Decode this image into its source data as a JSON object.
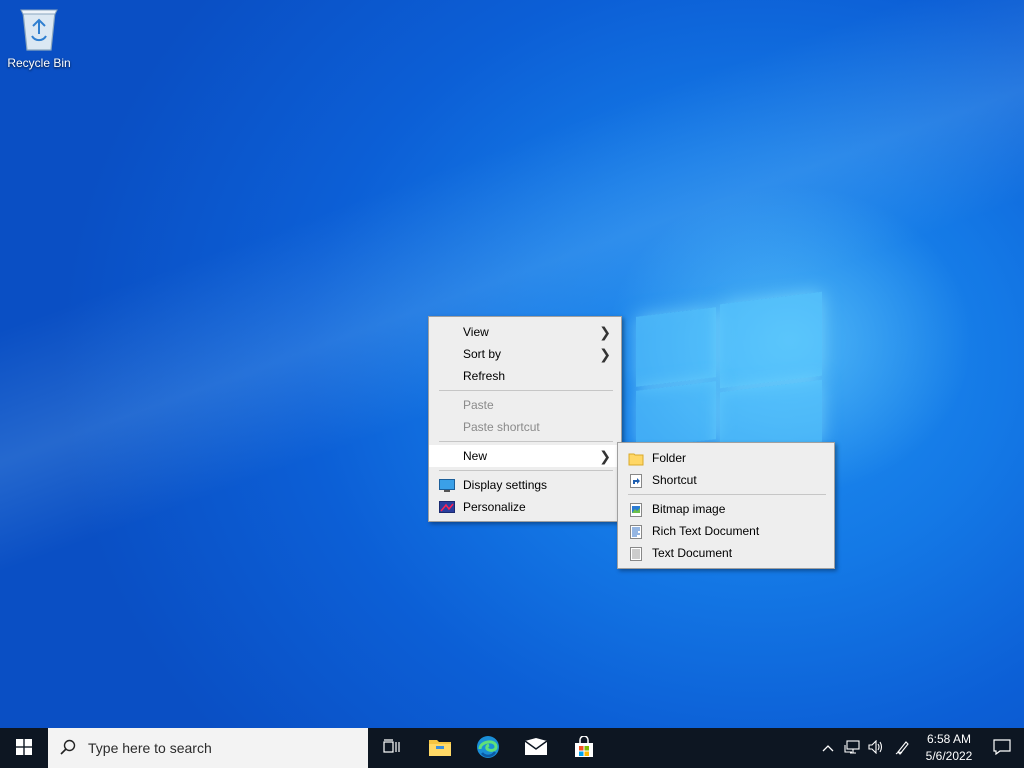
{
  "desktop": {
    "icons": [
      {
        "label": "Recycle Bin",
        "icon": "recycle-bin-icon"
      }
    ]
  },
  "context_menu": {
    "items": [
      {
        "label": "View",
        "submenu": true
      },
      {
        "label": "Sort by",
        "submenu": true
      },
      {
        "label": "Refresh"
      },
      {
        "label": "Paste",
        "disabled": true
      },
      {
        "label": "Paste shortcut",
        "disabled": true
      },
      {
        "label": "New",
        "submenu": true,
        "active": true
      },
      {
        "label": "Display settings",
        "icon": "display-settings-icon"
      },
      {
        "label": "Personalize",
        "icon": "personalize-icon"
      }
    ]
  },
  "new_submenu": {
    "items": [
      {
        "label": "Folder",
        "icon": "folder-icon"
      },
      {
        "label": "Shortcut",
        "icon": "shortcut-icon"
      },
      {
        "label": "Bitmap image",
        "icon": "bitmap-image-icon"
      },
      {
        "label": "Rich Text Document",
        "icon": "rich-text-document-icon"
      },
      {
        "label": "Text Document",
        "icon": "text-document-icon"
      }
    ]
  },
  "taskbar": {
    "search_placeholder": "Type here to search",
    "pinned": [
      "task-view-icon",
      "file-explorer-icon",
      "edge-icon",
      "mail-icon",
      "store-icon"
    ],
    "tray_icons": [
      "show-hidden-icons-chevron-icon",
      "network-icon",
      "volume-icon",
      "pen-icon"
    ],
    "clock": {
      "time": "6:58 AM",
      "date": "5/6/2022"
    }
  },
  "colors": {
    "menu_bg": "#eeeeee",
    "menu_active": "#ffffff",
    "taskbar_bg": "#0d1622",
    "desktop_accent": "#1479e6"
  }
}
